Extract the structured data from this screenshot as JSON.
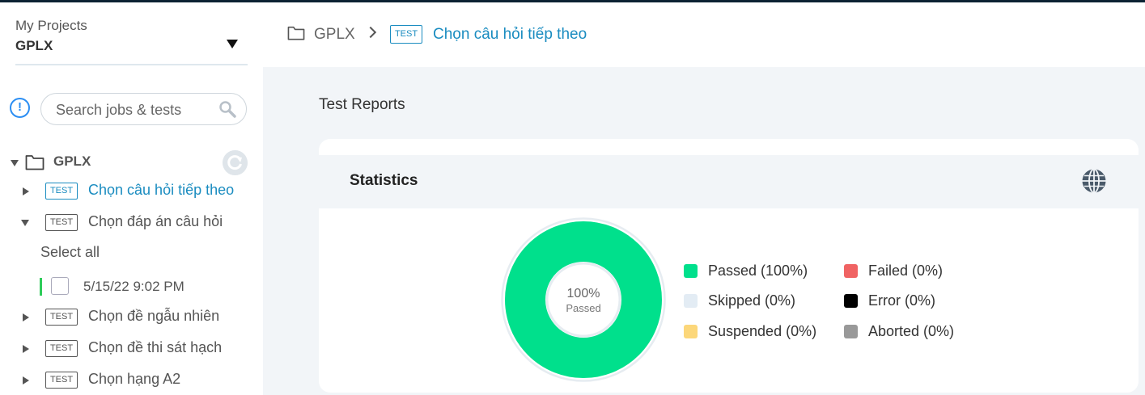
{
  "sidebar": {
    "project_label": "My Projects",
    "project_name": "GPLX",
    "search": {
      "placeholder": "Search jobs & tests"
    },
    "tree": {
      "root_label": "GPLX",
      "items": [
        {
          "badge": "TEST",
          "label": "Chọn câu hỏi tiếp theo",
          "active": true,
          "expanded": false
        },
        {
          "badge": "TEST",
          "label": "Chọn đáp án câu hỏi",
          "active": false,
          "expanded": true
        },
        {
          "badge": "TEST",
          "label": "Chọn đề ngẫu nhiên",
          "active": false,
          "expanded": false
        },
        {
          "badge": "TEST",
          "label": "Chọn đề thi sát hạch",
          "active": false,
          "expanded": false
        },
        {
          "badge": "TEST",
          "label": "Chọn hạng A2",
          "active": false,
          "expanded": false
        }
      ],
      "select_all": "Select all",
      "run": {
        "label": "5/15/22 9:02 PM",
        "status_color": "#2ecc5a"
      }
    }
  },
  "breadcrumb": {
    "root": "GPLX",
    "badge": "TEST",
    "current": "Chọn câu hỏi tiếp theo"
  },
  "main": {
    "section_title": "Test Reports",
    "card_title": "Statistics",
    "donut": {
      "percent": "100%",
      "label": "Passed"
    },
    "legend": [
      {
        "label": "Passed (100%)",
        "color": "#00e08c",
        "value": 100
      },
      {
        "label": "Skipped (0%)",
        "color": "#e3ecf4",
        "value": 0
      },
      {
        "label": "Suspended (0%)",
        "color": "#fcd77a",
        "value": 0
      },
      {
        "label": "Failed (0%)",
        "color": "#f06363",
        "value": 0
      },
      {
        "label": "Error (0%)",
        "color": "#000000",
        "value": 0
      },
      {
        "label": "Aborted (0%)",
        "color": "#999999",
        "value": 0
      }
    ]
  },
  "colors": {
    "accent": "#1a8cc0",
    "info": "#2b8ef3",
    "passed": "#00e08c"
  }
}
